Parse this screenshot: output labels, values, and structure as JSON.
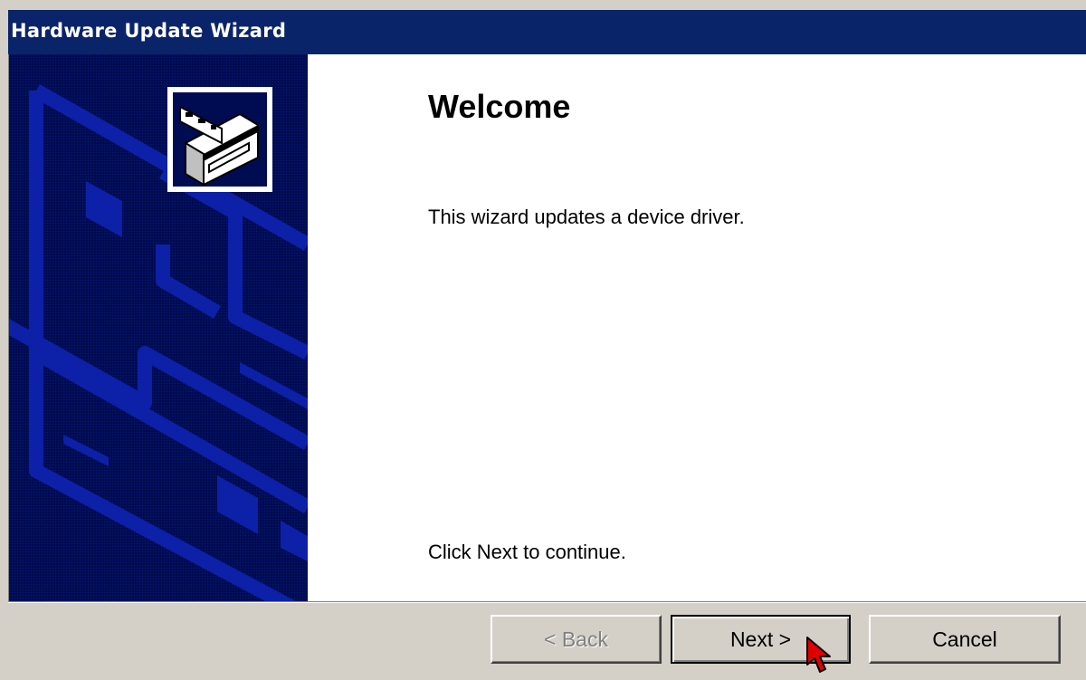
{
  "window": {
    "title": "Hardware Update Wizard"
  },
  "main": {
    "heading": "Welcome",
    "intro": "This wizard updates a device driver.",
    "instruction": "Click Next to continue."
  },
  "buttons": {
    "back": {
      "label": "< Back",
      "enabled": false
    },
    "next": {
      "label": "Next >",
      "enabled": true,
      "default": true
    },
    "cancel": {
      "label": "Cancel",
      "enabled": true
    }
  },
  "icons": {
    "wizard": "hardware-drive-icon",
    "cursor": "mouse-pointer-icon"
  },
  "colors": {
    "titlebar": "#0a246a",
    "side_panel": "#000c52",
    "side_art": "#0a1a8a",
    "dialog_face": "#d4d0c8",
    "cursor": "#e00000"
  }
}
